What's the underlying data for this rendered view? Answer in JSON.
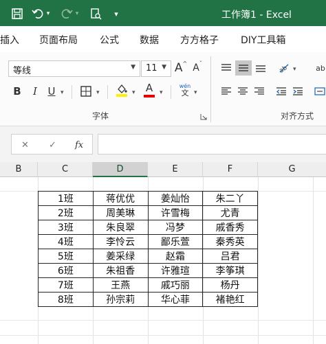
{
  "titlebar": {
    "title": "工作簿1  -  Excel",
    "icons": [
      "save-icon",
      "undo-icon",
      "redo-icon",
      "print-preview-icon",
      "customize-toolbar-icon"
    ],
    "color": "#217346"
  },
  "tabs": [
    "插入",
    "页面布局",
    "公式",
    "数据",
    "方方格子",
    "DIY工具箱"
  ],
  "ribbon": {
    "font_name": "等线",
    "font_size": "11",
    "grow_font": "A",
    "shrink_font": "A",
    "bold": "B",
    "italic": "I",
    "underline": "U",
    "font_color_letter": "A",
    "pinyin_top": "wén",
    "pinyin_bottom": "文",
    "group_font": "字体",
    "group_alignment": "对齐方式",
    "highlight_color": "#ffef00",
    "font_color": "#e60000"
  },
  "formula_bar": {
    "cancel_icon": "✕",
    "enter_icon": "✓",
    "fx_label": "fx",
    "value": ""
  },
  "columns": [
    "B",
    "C",
    "D",
    "E",
    "F",
    "G"
  ],
  "selected_column": "D",
  "table": {
    "rows": [
      [
        "1班",
        "蒋优优",
        "姜灿怡",
        "朱二丫"
      ],
      [
        "2班",
        "周美琳",
        "许雪梅",
        "尤青"
      ],
      [
        "3班",
        "朱良翠",
        "冯梦",
        "戚香秀"
      ],
      [
        "4班",
        "李怜云",
        "鄙乐萱",
        "秦秀英"
      ],
      [
        "5班",
        "姜采绿",
        "赵霜",
        "吕君"
      ],
      [
        "6班",
        "朱祖香",
        "许雅瑄",
        "李筝琪"
      ],
      [
        "7班",
        "王燕",
        "戚巧丽",
        "杨丹"
      ],
      [
        "8班",
        "孙宗莉",
        "华心菲",
        "褚艳红"
      ]
    ]
  }
}
